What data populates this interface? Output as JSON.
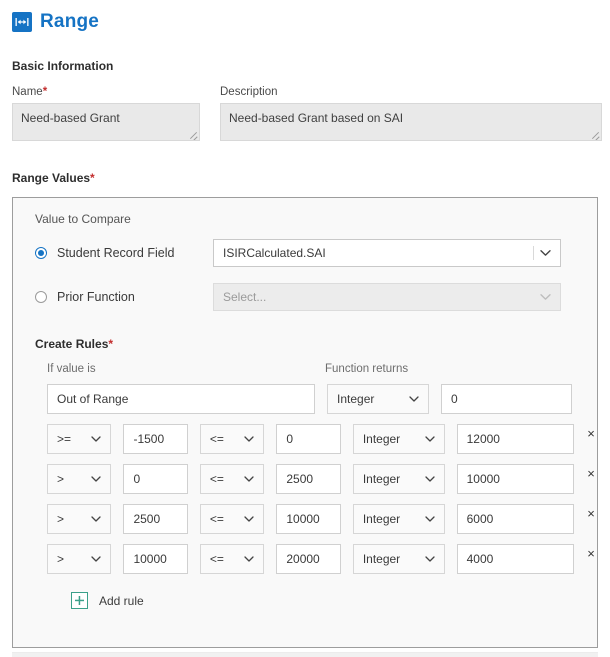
{
  "header": {
    "title": "Range",
    "icon": "range-arrows-icon"
  },
  "basic_information": {
    "heading": "Basic Information",
    "name": {
      "label": "Name",
      "required_marker": "*",
      "value": "Need-based Grant"
    },
    "description": {
      "label": "Description",
      "value": "Need-based Grant based on SAI"
    }
  },
  "range_values": {
    "heading": "Range Values",
    "required_marker": "*",
    "value_to_compare_label": "Value to Compare",
    "options": [
      {
        "label": "Student Record Field",
        "selected": true,
        "select_value": "ISIRCalculated.SAI",
        "disabled": false
      },
      {
        "label": "Prior Function",
        "selected": false,
        "select_value": "Select...",
        "disabled": true
      }
    ],
    "create_rules": {
      "heading": "Create Rules",
      "required_marker": "*",
      "columns": {
        "if_value_is": "If value is",
        "function_returns": "Function returns"
      },
      "default_row": {
        "label": "Out of Range",
        "return_type": "Integer",
        "return_value": "0"
      },
      "rows": [
        {
          "op_low": ">=",
          "val_low": "-1500",
          "op_high": "<=",
          "val_high": "0",
          "return_type": "Integer",
          "return_value": "12000",
          "delete": "×"
        },
        {
          "op_low": ">",
          "val_low": "0",
          "op_high": "<=",
          "val_high": "2500",
          "return_type": "Integer",
          "return_value": "10000",
          "delete": "×"
        },
        {
          "op_low": ">",
          "val_low": "2500",
          "op_high": "<=",
          "val_high": "10000",
          "return_type": "Integer",
          "return_value": "6000",
          "delete": "×"
        },
        {
          "op_low": ">",
          "val_low": "10000",
          "op_high": "<=",
          "val_high": "20000",
          "return_type": "Integer",
          "return_value": "4000",
          "delete": "×"
        }
      ],
      "add_rule_label": "Add rule"
    }
  },
  "colors": {
    "brand_blue": "#1573c4",
    "required_red": "#c32e2e",
    "add_green": "#3aa08a",
    "panel_border": "#9d9d9d",
    "panel_bg": "#f9f9f9"
  }
}
